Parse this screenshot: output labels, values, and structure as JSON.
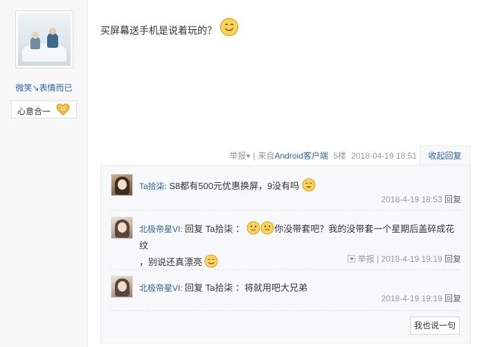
{
  "user": {
    "name": "微笑↘表情而已",
    "badge_name": "心意合一",
    "badge_level": "11"
  },
  "post": {
    "text": "买屏幕送手机是说着玩的？",
    "report": "举报",
    "source_prefix": "来自",
    "source": "Android客户端",
    "floor": "5楼",
    "time": "2018-04-19 18:51",
    "fold_reply": "收起回复"
  },
  "replies": [
    {
      "name": "Ta拾柒:",
      "content": "S8都有500元优惠换屏，9没有吗",
      "time": "2018-4-19 18:53",
      "reply_label": "回复"
    },
    {
      "name": "北极帝星VI:",
      "prefix": "回复 Ta拾柒 ：",
      "content_line1": "你没带套吧？我的没带套一个星期后盖碎成花纹",
      "content_line2": "，别说还真漂亮",
      "report": "举报",
      "time": "2018-4-19 19:19",
      "reply_label": "回复"
    },
    {
      "name": "北极帝星VI:",
      "content": "回复 Ta拾柒 ：将就用吧大兄弟",
      "time": "2018-4-19 19:19",
      "reply_label": "回复"
    }
  ],
  "actions": {
    "say_label": "我也说一句"
  },
  "colors": {
    "link": "#2d64b3",
    "meta": "#999999",
    "panel_bg": "#f7f8fa"
  }
}
